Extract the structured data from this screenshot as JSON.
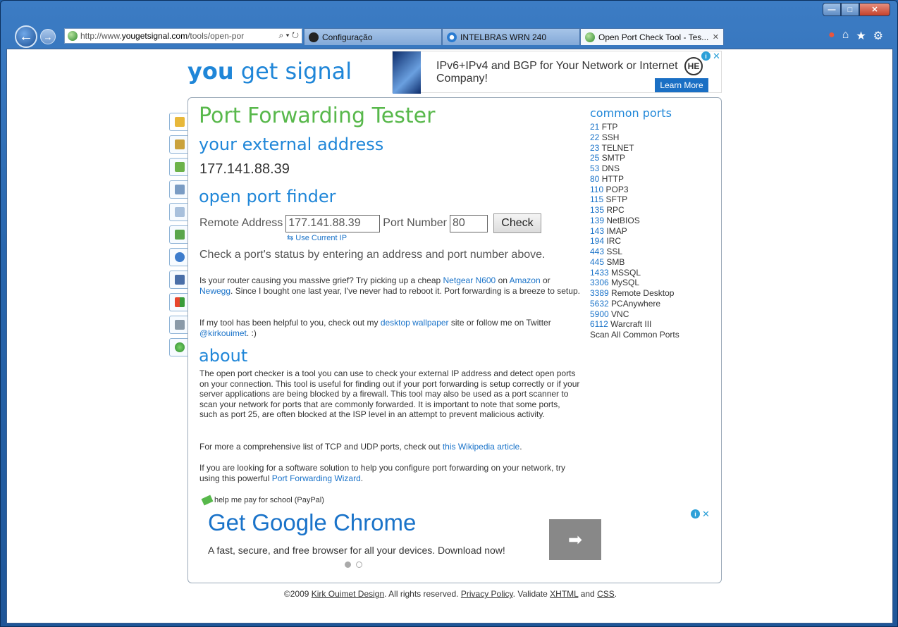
{
  "browser": {
    "url_prefix": "http://www.",
    "url_domain": "yougetsignal.com",
    "url_path": "/tools/open-por",
    "addr_tools": "⌕ ▾ ↻",
    "tabs": [
      {
        "label": "Configuração",
        "active": false
      },
      {
        "label": "INTELBRAS WRN 240",
        "active": false
      },
      {
        "label": "Open Port Check Tool - Tes...",
        "active": true
      }
    ],
    "tab_close": "✕"
  },
  "site": {
    "logo_you": "you",
    "logo_rest": "get signal"
  },
  "ad_top": {
    "text": "IPv6+IPv4 and BGP for Your Network or Internet Company!",
    "logo": "HE",
    "button": "Learn More"
  },
  "adchoices": {
    "i": "i",
    "x": "✕"
  },
  "main": {
    "title": "Port Forwarding Tester",
    "ext_heading": "your external address",
    "ip": "177.141.88.39",
    "finder_heading": "open port finder",
    "remote_label": "Remote Address",
    "remote_value": "177.141.88.39",
    "port_label": "Port Number",
    "port_value": "80",
    "check_label": "Check",
    "use_current": "Use Current IP",
    "instruction": "Check a port's status by entering an address and port number above.",
    "p1": [
      "Is your router causing you massive grief? Try picking up a cheap ",
      "Netgear N600",
      " on ",
      "Amazon",
      " or ",
      "Newegg",
      ". Since I bought one last year, I've never had to reboot it. Port forwarding is a breeze to setup."
    ],
    "p2": [
      "If my tool has been helpful to you, check out my ",
      "desktop wallpaper",
      " site or follow me on Twitter ",
      "@kirkouimet",
      ". :)"
    ],
    "about_heading": "about",
    "about_text": "The open port checker is a tool you can use to check your external IP address and detect open ports on your connection. This tool is useful for finding out if your port forwarding is setup correctly or if your server applications are being blocked by a firewall. This tool may also be used as a port scanner to scan your network for ports that are commonly forwarded. It is important to note that some ports, such as port 25, are often blocked at the ISP level in an attempt to prevent malicious activity.",
    "p3": [
      "For more a comprehensive list of TCP and UDP ports, check out ",
      "this Wikipedia article",
      "."
    ],
    "p4": [
      "If you are looking for a software solution to help you configure port forwarding on your network, try using this powerful ",
      "Port Forwarding Wizard",
      "."
    ],
    "paypal": "help me pay for school (PayPal)"
  },
  "ad_bottom": {
    "title": "Get Google Chrome",
    "subtitle": "A fast, secure, and free browser for all your devices. Download now!",
    "arrow": "➡"
  },
  "ports": {
    "title": "common ports",
    "items": [
      {
        "num": "21",
        "name": "FTP"
      },
      {
        "num": "22",
        "name": "SSH"
      },
      {
        "num": "23",
        "name": "TELNET"
      },
      {
        "num": "25",
        "name": "SMTP"
      },
      {
        "num": "53",
        "name": "DNS"
      },
      {
        "num": "80",
        "name": "HTTP"
      },
      {
        "num": "110",
        "name": "POP3"
      },
      {
        "num": "115",
        "name": "SFTP"
      },
      {
        "num": "135",
        "name": "RPC"
      },
      {
        "num": "139",
        "name": "NetBIOS"
      },
      {
        "num": "143",
        "name": "IMAP"
      },
      {
        "num": "194",
        "name": "IRC"
      },
      {
        "num": "443",
        "name": "SSL"
      },
      {
        "num": "445",
        "name": "SMB"
      },
      {
        "num": "1433",
        "name": "MSSQL"
      },
      {
        "num": "3306",
        "name": "MySQL"
      },
      {
        "num": "3389",
        "name": "Remote Desktop"
      },
      {
        "num": "5632",
        "name": "PCAnywhere"
      },
      {
        "num": "5900",
        "name": "VNC"
      },
      {
        "num": "6112",
        "name": "Warcraft III"
      }
    ],
    "scan_all": "Scan All Common Ports"
  },
  "footer": {
    "copyright": "©2009 ",
    "author": "Kirk Ouimet Design",
    "rights": ". All rights reserved. ",
    "privacy": "Privacy Policy",
    "validate": ". Validate ",
    "xhtml": "XHTML",
    "and": " and ",
    "css": "CSS",
    "end": "."
  }
}
